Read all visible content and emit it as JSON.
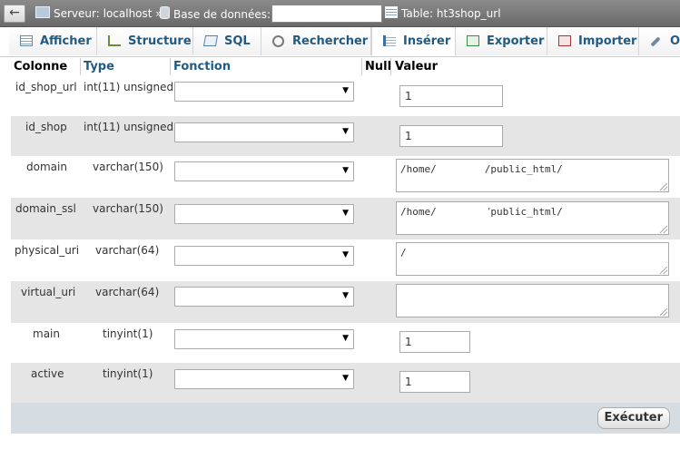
{
  "breadcrumb": {
    "server_label": "Serveur: localhost »",
    "database_label": "Base de données:",
    "database_value": "",
    "table_label": "Table: ht3shop_url"
  },
  "tabs": [
    {
      "label": "Afficher",
      "icon": "browse-icon"
    },
    {
      "label": "Structure",
      "icon": "structure-icon"
    },
    {
      "label": "SQL",
      "icon": "sql-icon"
    },
    {
      "label": "Rechercher",
      "icon": "search-icon"
    },
    {
      "label": "Insérer",
      "icon": "insert-icon",
      "active": true
    },
    {
      "label": "Exporter",
      "icon": "export-icon"
    },
    {
      "label": "Importer",
      "icon": "import-icon"
    },
    {
      "label": "O",
      "icon": "wrench-icon"
    }
  ],
  "columns_header": {
    "colonne": "Colonne",
    "type": "Type",
    "fonction": "Fonction",
    "null": "Null",
    "valeur": "Valeur"
  },
  "rows": [
    {
      "name": "id_shop_url",
      "type": "int(11) unsigned",
      "function": "",
      "value": "1"
    },
    {
      "name": "id_shop",
      "type": "int(11) unsigned",
      "function": "",
      "value": "1"
    },
    {
      "name": "domain",
      "type": "varchar(150)",
      "function": "",
      "value": "/home/        /public_html/"
    },
    {
      "name": "domain_ssl",
      "type": "varchar(150)",
      "function": "",
      "value": "/home/        /public_html/"
    },
    {
      "name": "physical_uri",
      "type": "varchar(64)",
      "function": "",
      "value": "/"
    },
    {
      "name": "virtual_uri",
      "type": "varchar(64)",
      "function": "",
      "value": ""
    },
    {
      "name": "main",
      "type": "tinyint(1)",
      "function": "",
      "value": "1"
    },
    {
      "name": "active",
      "type": "tinyint(1)",
      "function": "",
      "value": "1"
    }
  ],
  "footer": {
    "execute_label": "Exécuter"
  },
  "colors": {
    "topbar": "#7a7a7a",
    "link": "#235a81",
    "row_alt": "#e5e5e5",
    "footer": "#d5dde3"
  }
}
